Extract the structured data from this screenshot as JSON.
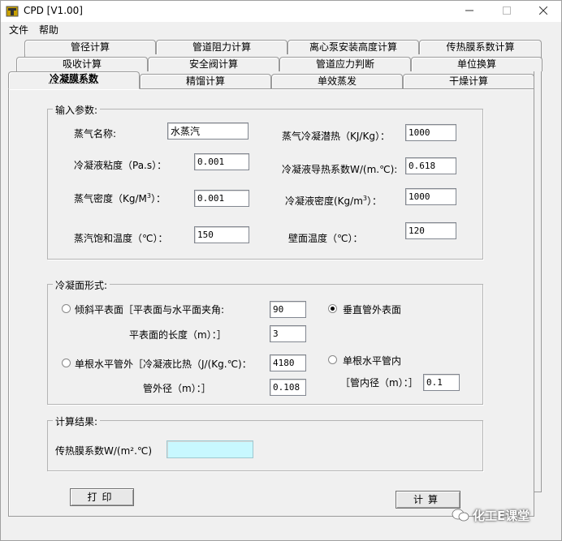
{
  "window": {
    "title": "CPD [V1.00]"
  },
  "menu": [
    "文件",
    "帮助"
  ],
  "tabs": {
    "row1": [
      "管径计算",
      "管道阻力计算",
      "离心泵安装高度计算",
      "传热膜系数计算"
    ],
    "row2": [
      "吸收计算",
      "安全阀计算",
      "管道应力判断",
      "单位换算"
    ],
    "row3": [
      "冷凝膜系数",
      "精馏计算",
      "单效蒸发",
      "干燥计算"
    ]
  },
  "input_group": {
    "title": "输入参数:",
    "steam_name_label": "蒸气名称:",
    "steam_name": "水蒸汽",
    "latent_heat_label": "蒸气冷凝潜热（KJ/Kg）：",
    "latent_heat": "1000",
    "viscosity_label": "冷凝液粘度（Pa.s）：",
    "viscosity": "0.001",
    "conductivity_label": "冷凝液导热系数W/(m.℃):",
    "conductivity": "0.618",
    "vapor_density_label": "蒸气密度（Kg/M",
    "vapor_density_sup": "3",
    "vapor_density_suffix": "）：",
    "vapor_density": "0.001",
    "condensate_density_label": "冷凝液密度(Kg/m",
    "condensate_density_sup": "3",
    "condensate_density_suffix": "）：",
    "condensate_density": "1000",
    "sat_temp_label": "蒸汽饱和温度（℃）：",
    "sat_temp": "150",
    "wall_temp_label": "壁面温度（℃）：",
    "wall_temp": "120"
  },
  "form_group": {
    "title": "冷凝面形式:",
    "inclined_label": "倾斜平表面［平表面与水平面夹角:",
    "inclined_angle": "90",
    "plane_length_label": "平表面的长度（m）：］",
    "plane_length": "3",
    "vertical_label": "垂直管外表面",
    "horizontal_outer_label": "单根水平管外［冷凝液比热（J/(Kg.℃)：",
    "specific_heat": "4180",
    "outer_dia_label": "管外径（m）：］",
    "outer_dia": "0.108",
    "horizontal_inner_label": "单根水平管内",
    "inner_dia_label": "［管内径（m）：］",
    "inner_dia": "0.1",
    "selected": "vertical"
  },
  "result_group": {
    "title": "计算结果:",
    "coef_label": "传热膜系数W/(m².℃)",
    "coef_value": ""
  },
  "buttons": {
    "print": "打印",
    "calc": "计算"
  },
  "watermark": "化工E课堂"
}
